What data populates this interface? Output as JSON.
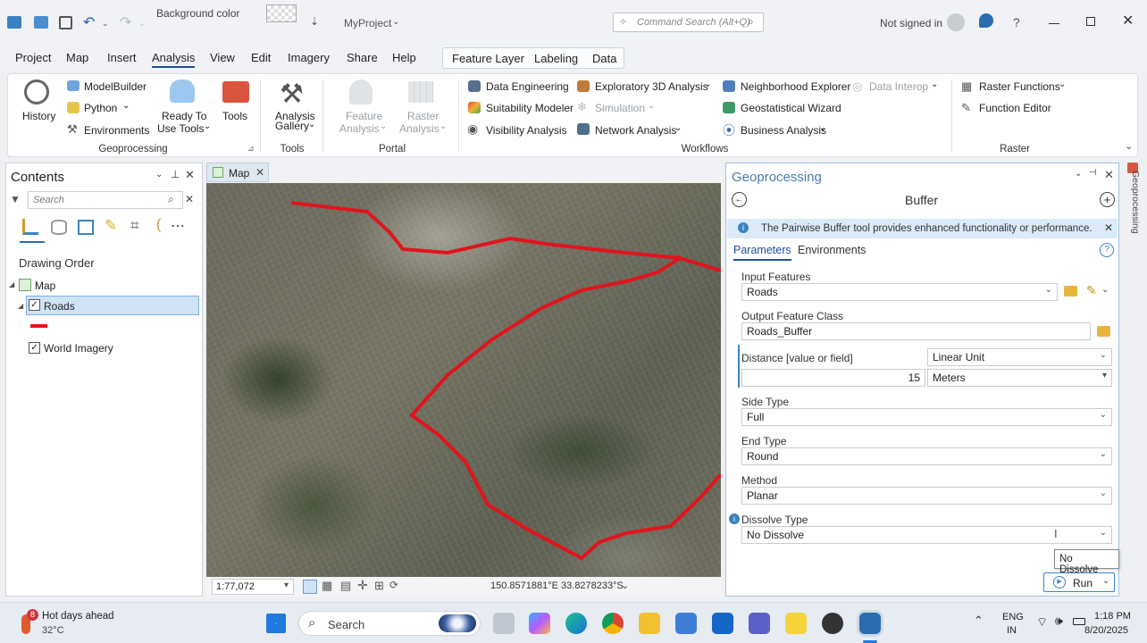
{
  "qat": {
    "bg_label": "Background color",
    "project": "MyProject",
    "command_search": "Command Search (Alt+Q)",
    "signin": "Not signed in",
    "help": "?"
  },
  "menu": {
    "items": [
      "Project",
      "Map",
      "Insert",
      "Analysis",
      "View",
      "Edit",
      "Imagery",
      "Share",
      "Help"
    ],
    "context": [
      "Feature Layer",
      "Labeling",
      "Data"
    ]
  },
  "ribbon": {
    "history": "History",
    "modelbuilder": "ModelBuilder",
    "python": "Python",
    "environments": "Environments",
    "ready_to": "Ready To",
    "use_tools": "Use Tools",
    "tools": "Tools",
    "analysis": "Analysis",
    "gallery": "Gallery",
    "feature": "Feature",
    "feature_analysis": "Analysis",
    "raster": "Raster",
    "raster_analysis": "Analysis",
    "data_eng": "Data Engineering",
    "suitability": "Suitability Modeler",
    "visibility": "Visibility Analysis",
    "explore3d": "Exploratory 3D Analysis",
    "simulation": "Simulation",
    "network": "Network Analysis",
    "neighborhood": "Neighborhood Explorer",
    "geostat": "Geostatistical Wizard",
    "business": "Business Analysis",
    "interop": "Data Interop",
    "raster_functions": "Raster Functions",
    "function_editor": "Function Editor",
    "groups": {
      "geoprocessing": "Geoprocessing",
      "tools": "Tools",
      "portal": "Portal",
      "workflows": "Workflows",
      "raster": "Raster"
    }
  },
  "contents": {
    "title": "Contents",
    "search_placeholder": "Search",
    "drawing_order": "Drawing Order",
    "map": "Map",
    "roads": "Roads",
    "world_imagery": "World Imagery"
  },
  "map": {
    "tab": "Map",
    "scale": "1:77,072",
    "coords": "150.8571881°E 33.8278233°S"
  },
  "gp": {
    "title": "Geoprocessing",
    "tool": "Buffer",
    "info": "The Pairwise Buffer tool provides enhanced functionality or performance.",
    "tab_params": "Parameters",
    "tab_env": "Environments",
    "input_label": "Input Features",
    "input_value": "Roads",
    "output_label": "Output Feature Class",
    "output_value": "Roads_Buffer",
    "distance_label": "Distance [value or field]",
    "distance_type": "Linear Unit",
    "distance_value": "15",
    "distance_unit": "Meters",
    "side_label": "Side Type",
    "side_value": "Full",
    "end_label": "End Type",
    "end_value": "Round",
    "method_label": "Method",
    "method_value": "Planar",
    "dissolve_label": "Dissolve Type",
    "dissolve_value": "No Dissolve",
    "tooltip": "No Dissolve",
    "run": "Run",
    "side_tab": "Geoprocessing"
  },
  "taskbar": {
    "weather_title": "Hot days ahead",
    "temp": "32°C",
    "badge": "8",
    "search": "Search",
    "lang1": "ENG",
    "lang2": "IN",
    "time": "1:18 PM",
    "date": "8/20/2025"
  }
}
